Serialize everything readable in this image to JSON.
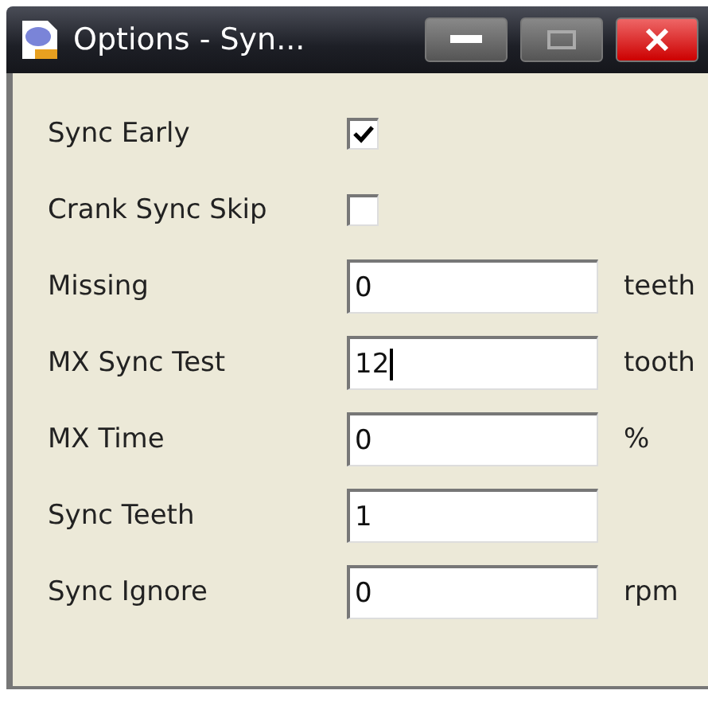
{
  "window": {
    "title": "Options - Syn..."
  },
  "rows": [
    {
      "kind": "checkbox",
      "label": "Sync Early",
      "checked": true
    },
    {
      "kind": "checkbox",
      "label": "Crank Sync Skip",
      "checked": false
    },
    {
      "kind": "field",
      "label": "Missing",
      "value": "0",
      "unit": "teeth",
      "focused": false
    },
    {
      "kind": "field",
      "label": "MX Sync Test",
      "value": "12",
      "unit": "tooth",
      "focused": true
    },
    {
      "kind": "field",
      "label": "MX Time",
      "value": "0",
      "unit": "%",
      "focused": false
    },
    {
      "kind": "field",
      "label": "Sync Teeth",
      "value": "1",
      "focused": false
    },
    {
      "kind": "field",
      "label": "Sync Ignore",
      "value": "0",
      "unit": "rpm",
      "focused": false
    }
  ]
}
